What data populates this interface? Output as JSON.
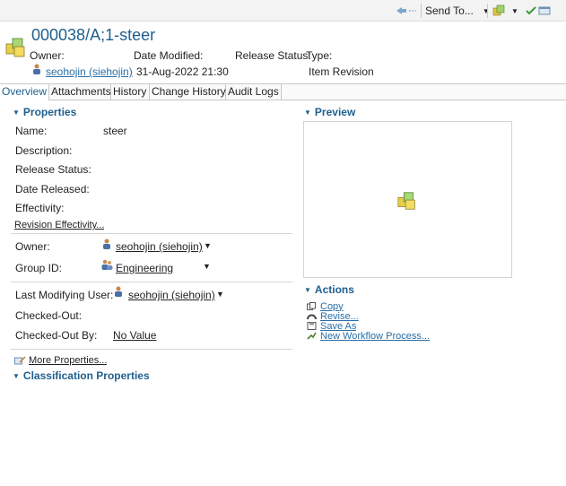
{
  "toolbar": {
    "send_to": "Send To..."
  },
  "header": {
    "title": "000038/A;1-steer",
    "labels": {
      "owner": "Owner:",
      "date_modified": "Date Modified:",
      "release_status": "Release Status:",
      "type": "Type:"
    },
    "values": {
      "owner": "seohojin (siehojin)",
      "date_modified": "31-Aug-2022 21:30",
      "type": "Item Revision"
    }
  },
  "tabs": [
    "Overview",
    "Attachments",
    "History",
    "Change History",
    "Audit Logs"
  ],
  "properties": {
    "heading": "Properties",
    "name_label": "Name:",
    "name_value": "steer",
    "description_label": "Description:",
    "release_status_label": "Release Status:",
    "date_released_label": "Date Released:",
    "effectivity_label": "Effectivity:",
    "revision_effectivity_link": "Revision Effectivity...",
    "owner_label": "Owner:",
    "owner_value": "seohojin (siehojin)",
    "group_label": "Group ID:",
    "group_value": "Engineering",
    "last_modifying_label": "Last Modifying User:",
    "last_modifying_value": "seohojin (siehojin)",
    "checked_out_label": "Checked-Out:",
    "checked_out_by_label": "Checked-Out By:",
    "checked_out_by_value": "No Value",
    "more_properties": "More Properties..."
  },
  "classification": {
    "heading": "Classification Properties"
  },
  "preview": {
    "heading": "Preview"
  },
  "actions": {
    "heading": "Actions",
    "items": [
      "Copy",
      "Revise...",
      "Save As",
      "New Workflow Process..."
    ]
  }
}
